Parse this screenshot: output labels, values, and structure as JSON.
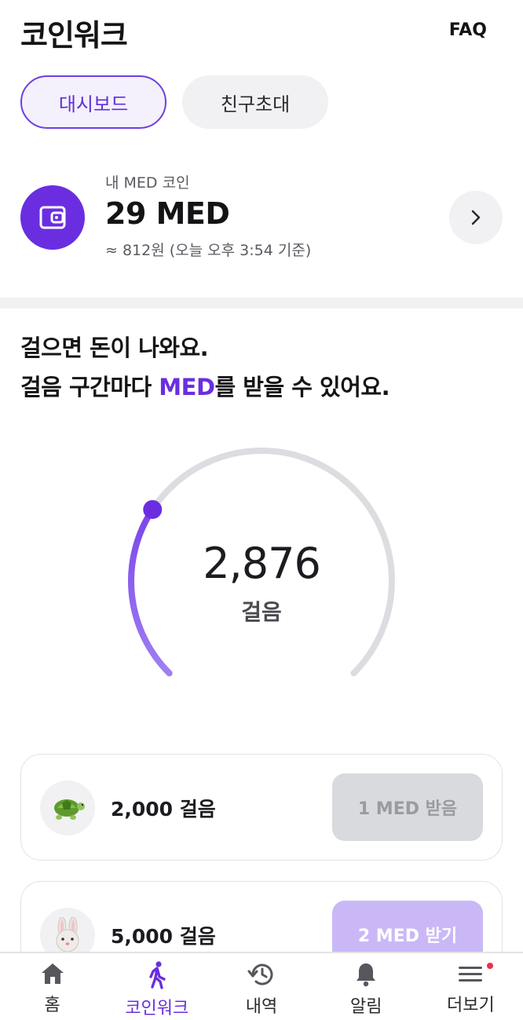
{
  "header": {
    "title": "코인워크",
    "faq_label": "FAQ"
  },
  "tabs": [
    {
      "label": "대시보드",
      "active": true
    },
    {
      "label": "친구초대",
      "active": false
    }
  ],
  "coin": {
    "label": "내 MED 코인",
    "amount": "29 MED",
    "subtext": "≈ 812원 (오늘 오후 3:54 기준)",
    "icon": "wallet-icon"
  },
  "headline": {
    "line1": "걸으면 돈이 나와요.",
    "line2_prefix": "걸음 구간마다 ",
    "line2_accent": "MED",
    "line2_suffix": "를 받을 수 있어요."
  },
  "gauge": {
    "steps": "2,876",
    "unit": "걸음",
    "progress_fraction": 0.29
  },
  "milestones": [
    {
      "icon": "turtle-icon",
      "label": "2,000 걸음",
      "button": "1 MED 받음",
      "state": "done"
    },
    {
      "icon": "rabbit-icon",
      "label": "5,000 걸음",
      "button": "2 MED 받기",
      "state": "claim"
    }
  ],
  "nav": [
    {
      "label": "홈",
      "icon": "home-icon",
      "active": false
    },
    {
      "label": "코인워크",
      "icon": "walking-icon",
      "active": true
    },
    {
      "label": "내역",
      "icon": "history-icon",
      "active": false
    },
    {
      "label": "알림",
      "icon": "bell-icon",
      "active": false
    },
    {
      "label": "더보기",
      "icon": "menu-icon",
      "active": false,
      "badge": true
    }
  ],
  "colors": {
    "accent": "#6a2ee0",
    "gauge_track": "#dcdde0",
    "gauge_fill": "#8b5cf0"
  }
}
